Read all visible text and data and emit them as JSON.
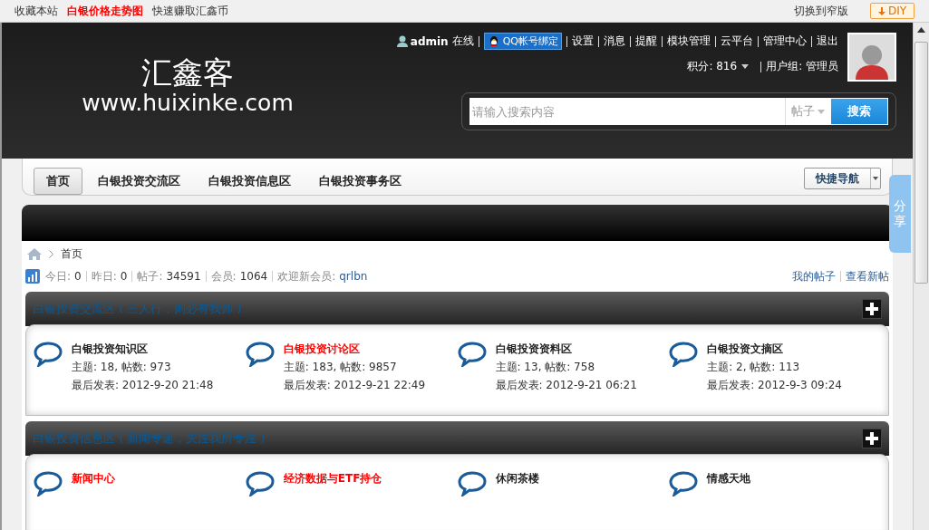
{
  "top_links": [
    {
      "label": "收藏本站",
      "highlight": false
    },
    {
      "label": "白银价格走势图",
      "highlight": true
    },
    {
      "label": "快速赚取汇鑫币",
      "highlight": false
    }
  ],
  "top_right": {
    "switch_link": "切换到窄版",
    "diy_button": "DIY"
  },
  "logo": {
    "name": "汇鑫客",
    "url": "www.huixinke.com"
  },
  "user": {
    "name": "admin",
    "status": "在线",
    "qq_bind": "QQ帐号绑定",
    "links": [
      "设置",
      "消息",
      "提醒",
      "模块管理",
      "云平台",
      "管理中心",
      "退出"
    ],
    "points": "积分: 816",
    "group": "用户组: 管理员"
  },
  "search": {
    "placeholder": "请输入搜索内容",
    "scope": "帖子",
    "button": "搜索"
  },
  "nav": [
    {
      "label": "首页",
      "selected": true
    },
    {
      "label": "白银投资交流区",
      "selected": false
    },
    {
      "label": "白银投资信息区",
      "selected": false
    },
    {
      "label": "白银投资事务区",
      "selected": false
    }
  ],
  "quick_nav": "快捷导航",
  "share_tab": "分享",
  "breadcrumb": [
    "首页"
  ],
  "stats": [
    {
      "label": "今日:",
      "value": "0"
    },
    {
      "label": "昨日:",
      "value": "0"
    },
    {
      "label": "帖子:",
      "value": "34591"
    },
    {
      "label": "会员:",
      "value": "1064"
    },
    {
      "label": "欢迎新会员:",
      "value": "qrlbn"
    }
  ],
  "stats_links": [
    "我的帖子",
    "查看新帖"
  ],
  "sections": [
    {
      "title": "白银投资交流区 ( 三人行，则必有我师 )",
      "forums": [
        {
          "name": "白银投资知识区",
          "has_new": false,
          "counts": "主题: 18, 帖数: 973",
          "last_post": "最后发表: 2012-9-20 21:48"
        },
        {
          "name": "白银投资讨论区",
          "has_new": true,
          "counts": "主题: 183, 帖数: 9857",
          "last_post": "最后发表: 2012-9-21 22:49"
        },
        {
          "name": "白银投资资料区",
          "has_new": false,
          "counts": "主题: 13, 帖数: 758",
          "last_post": "最后发表: 2012-9-21 06:21"
        },
        {
          "name": "白银投资文摘区",
          "has_new": false,
          "counts": "主题: 2, 帖数: 113",
          "last_post": "最后发表: 2012-9-3 09:24"
        }
      ]
    },
    {
      "title": "白银投资信息区 ( 新闻专递，关注我所专注 )",
      "forums": [
        {
          "name": "新闻中心",
          "has_new": true
        },
        {
          "name": "经济数据与ETF持仓",
          "has_new": true
        },
        {
          "name": "休闲茶楼",
          "has_new": false
        },
        {
          "name": "情感天地",
          "has_new": false
        }
      ]
    }
  ]
}
